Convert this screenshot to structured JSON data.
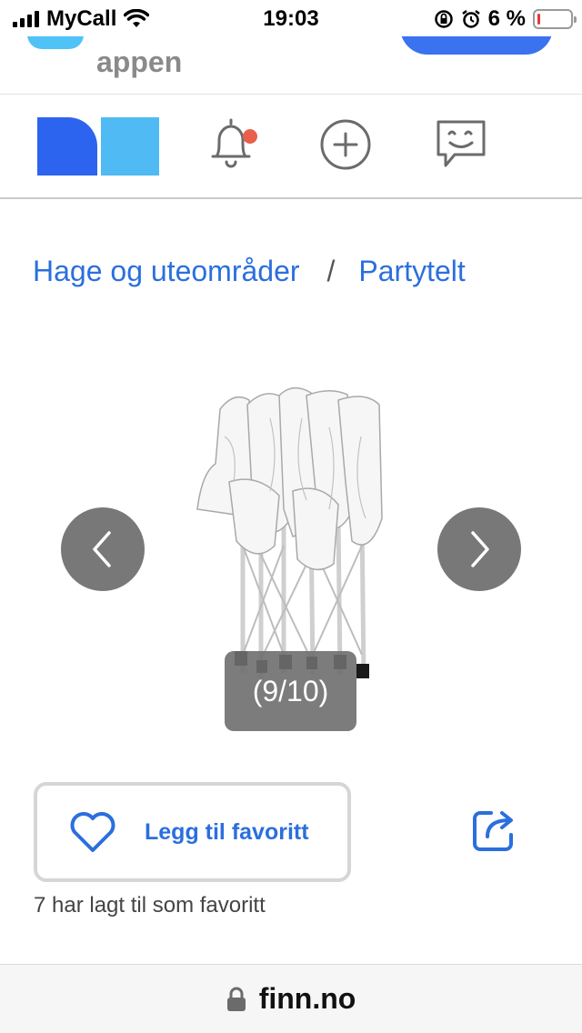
{
  "status_bar": {
    "carrier": "MyCall",
    "time": "19:03",
    "battery_percent_text": "6 %",
    "battery_level": 0.06,
    "battery_color": "#e53935",
    "icons": [
      "signal-icon",
      "wifi-icon",
      "rotation-lock-icon",
      "alarm-icon",
      "battery-icon"
    ]
  },
  "app_banner": {
    "text": "appen"
  },
  "header": {
    "icons": [
      "finn-logo",
      "bell-icon",
      "plus-circle-icon",
      "chat-smiley-icon"
    ],
    "notification_dot_color": "#e8604c"
  },
  "breadcrumb": {
    "items": [
      "Hage og uteområder",
      "Partytelt"
    ],
    "separator": "/"
  },
  "gallery": {
    "counter": "(9/10)",
    "current": 9,
    "total": 10,
    "image_description": "folded white party tent"
  },
  "favorite": {
    "button_label": "Legg til favoritt",
    "count_text": "7 har lagt til som favoritt"
  },
  "url_bar": {
    "domain": "finn.no"
  },
  "colors": {
    "accent_blue": "#2b6fde",
    "logo_dark_blue": "#2c64ef",
    "logo_light_blue": "#4fbaf3",
    "nav_button_gray": "#787878"
  }
}
